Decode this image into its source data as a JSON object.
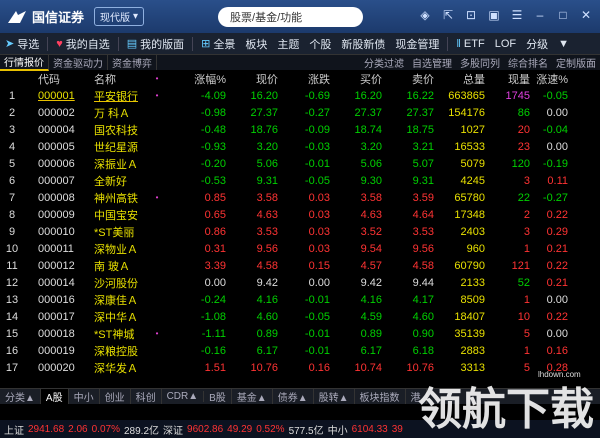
{
  "app": {
    "logo_text": "国信证券",
    "edition": "现代版",
    "search_placeholder": "股票/基金/功能"
  },
  "toolbar": {
    "items": [
      "导选",
      "我的自选",
      "我的版面",
      "全景",
      "板块",
      "主题",
      "个股",
      "新股新债",
      "现金管理",
      "ETF",
      "LOF",
      "分级"
    ]
  },
  "subtabs": {
    "left": [
      "行情报价",
      "资金驱动力",
      "资金博弈"
    ],
    "right": [
      "分类过滤",
      "自选管理",
      "多股同列",
      "综合排名",
      "定制版面"
    ]
  },
  "table": {
    "headers": {
      "code": "代码",
      "name": "名称",
      "flag": "•",
      "chg_pct": "涨幅%",
      "price": "现价",
      "diff": "涨跌",
      "buy": "买价",
      "sell": "卖价",
      "volume": "总量",
      "cur_vol": "现量",
      "speed": "涨速%"
    },
    "rows": [
      {
        "idx": "1",
        "code": "000001",
        "name": "平安银行",
        "flag": "•",
        "chg": "-4.09",
        "price": "16.20",
        "diff": "-0.69",
        "buy": "16.20",
        "sell": "16.22",
        "vol": "663865",
        "cur": "1745",
        "spd": "-0.05",
        "dir": "dn",
        "curc": "mg",
        "spdc": "dn",
        "sel": true
      },
      {
        "idx": "2",
        "code": "000002",
        "name": "万 科Ａ",
        "flag": "",
        "chg": "-0.98",
        "price": "27.37",
        "diff": "-0.27",
        "buy": "27.37",
        "sell": "27.37",
        "vol": "154176",
        "cur": "86",
        "spd": "0.00",
        "dir": "dn",
        "curc": "dn",
        "spdc": "fl"
      },
      {
        "idx": "3",
        "code": "000004",
        "name": "国农科技",
        "flag": "",
        "chg": "-0.48",
        "price": "18.76",
        "diff": "-0.09",
        "buy": "18.74",
        "sell": "18.75",
        "vol": "1027",
        "cur": "20",
        "spd": "-0.04",
        "dir": "dn",
        "curc": "up",
        "spdc": "dn"
      },
      {
        "idx": "4",
        "code": "000005",
        "name": "世纪星源",
        "flag": "",
        "chg": "-0.93",
        "price": "3.20",
        "diff": "-0.03",
        "buy": "3.20",
        "sell": "3.21",
        "vol": "16533",
        "cur": "23",
        "spd": "0.00",
        "dir": "dn",
        "curc": "up",
        "spdc": "fl"
      },
      {
        "idx": "5",
        "code": "000006",
        "name": "深振业Ａ",
        "flag": "",
        "chg": "-0.20",
        "price": "5.06",
        "diff": "-0.01",
        "buy": "5.06",
        "sell": "5.07",
        "vol": "5079",
        "cur": "120",
        "spd": "-0.19",
        "dir": "dn",
        "curc": "dn",
        "spdc": "dn"
      },
      {
        "idx": "6",
        "code": "000007",
        "name": "全新好",
        "flag": "",
        "chg": "-0.53",
        "price": "9.31",
        "diff": "-0.05",
        "buy": "9.30",
        "sell": "9.31",
        "vol": "4245",
        "cur": "3",
        "spd": "0.11",
        "dir": "dn",
        "curc": "up",
        "spdc": "up"
      },
      {
        "idx": "7",
        "code": "000008",
        "name": "神州高铁",
        "flag": "•",
        "chg": "0.85",
        "price": "3.58",
        "diff": "0.03",
        "buy": "3.58",
        "sell": "3.59",
        "vol": "65780",
        "cur": "22",
        "spd": "-0.27",
        "dir": "up",
        "curc": "dn",
        "spdc": "dn"
      },
      {
        "idx": "8",
        "code": "000009",
        "name": "中国宝安",
        "flag": "",
        "chg": "0.65",
        "price": "4.63",
        "diff": "0.03",
        "buy": "4.63",
        "sell": "4.64",
        "vol": "17348",
        "cur": "2",
        "spd": "0.22",
        "dir": "up",
        "curc": "up",
        "spdc": "up"
      },
      {
        "idx": "9",
        "code": "000010",
        "name": "*ST美丽",
        "flag": "",
        "chg": "0.86",
        "price": "3.53",
        "diff": "0.03",
        "buy": "3.52",
        "sell": "3.53",
        "vol": "2403",
        "cur": "3",
        "spd": "0.29",
        "dir": "up",
        "curc": "up",
        "spdc": "up"
      },
      {
        "idx": "10",
        "code": "000011",
        "name": "深物业Ａ",
        "flag": "",
        "chg": "0.31",
        "price": "9.56",
        "diff": "0.03",
        "buy": "9.54",
        "sell": "9.56",
        "vol": "960",
        "cur": "1",
        "spd": "0.21",
        "dir": "up",
        "curc": "up",
        "spdc": "up"
      },
      {
        "idx": "11",
        "code": "000012",
        "name": "南 玻Ａ",
        "flag": "",
        "chg": "3.39",
        "price": "4.58",
        "diff": "0.15",
        "buy": "4.57",
        "sell": "4.58",
        "vol": "60790",
        "cur": "121",
        "spd": "0.22",
        "dir": "up",
        "curc": "up",
        "spdc": "up"
      },
      {
        "idx": "12",
        "code": "000014",
        "name": "沙河股份",
        "flag": "",
        "chg": "0.00",
        "price": "9.42",
        "diff": "0.00",
        "buy": "9.42",
        "sell": "9.44",
        "vol": "2133",
        "cur": "52",
        "spd": "0.21",
        "dir": "fl",
        "curc": "dn",
        "spdc": "up"
      },
      {
        "idx": "13",
        "code": "000016",
        "name": "深康佳Ａ",
        "flag": "",
        "chg": "-0.24",
        "price": "4.16",
        "diff": "-0.01",
        "buy": "4.16",
        "sell": "4.17",
        "vol": "8509",
        "cur": "1",
        "spd": "0.00",
        "dir": "dn",
        "curc": "up",
        "spdc": "fl"
      },
      {
        "idx": "14",
        "code": "000017",
        "name": "深中华Ａ",
        "flag": "",
        "chg": "-1.08",
        "price": "4.60",
        "diff": "-0.05",
        "buy": "4.59",
        "sell": "4.60",
        "vol": "18407",
        "cur": "10",
        "spd": "0.22",
        "dir": "dn",
        "curc": "up",
        "spdc": "up"
      },
      {
        "idx": "15",
        "code": "000018",
        "name": "*ST神城",
        "flag": "•",
        "chg": "-1.11",
        "price": "0.89",
        "diff": "-0.01",
        "buy": "0.89",
        "sell": "0.90",
        "vol": "35139",
        "cur": "5",
        "spd": "0.00",
        "dir": "dn",
        "curc": "up",
        "spdc": "fl"
      },
      {
        "idx": "16",
        "code": "000019",
        "name": "深粮控股",
        "flag": "",
        "chg": "-0.16",
        "price": "6.17",
        "diff": "-0.01",
        "buy": "6.17",
        "sell": "6.18",
        "vol": "2883",
        "cur": "1",
        "spd": "0.16",
        "dir": "dn",
        "curc": "up",
        "spdc": "up"
      },
      {
        "idx": "17",
        "code": "000020",
        "name": "深华发Ａ",
        "flag": "",
        "chg": "1.51",
        "price": "10.76",
        "diff": "0.16",
        "buy": "10.74",
        "sell": "10.76",
        "vol": "3313",
        "cur": "5",
        "spd": "0.28",
        "dir": "up",
        "curc": "up",
        "spdc": "up"
      }
    ]
  },
  "bottom_tabs": [
    "分类▲",
    "A股",
    "中小",
    "创业",
    "科创",
    "CDR▲",
    "B股",
    "基金▲",
    "债券▲",
    "股转▲",
    "板块指数",
    "港"
  ],
  "status": {
    "sh_label": "上证",
    "sh_val": "2941.68",
    "sh_chg": "2.06",
    "sh_pct": "0.07%",
    "sh_amt": "289.2亿",
    "sz_label": "深证",
    "sz_val": "9602.86",
    "sz_chg": "49.29",
    "sz_pct": "0.52%",
    "sz_amt": "577.5亿",
    "zx_label": "中小",
    "zx_val": "6104.33",
    "zx_rest": "39"
  },
  "watermark": {
    "text": "领航下载",
    "site": "lhdown.com"
  },
  "colors": {
    "up": "#ff3333",
    "down": "#00d000",
    "accent": "#e8c000",
    "titlebar": "#1c3a6c"
  }
}
